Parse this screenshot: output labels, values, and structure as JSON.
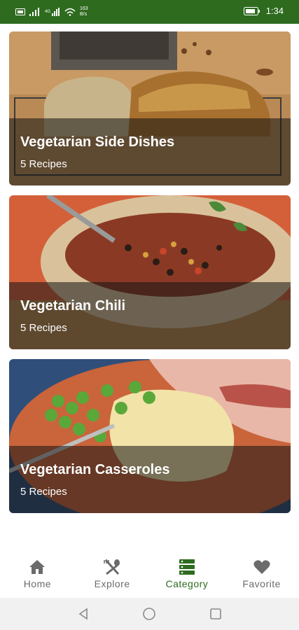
{
  "status_bar": {
    "speed_value": "163",
    "speed_unit": "B/s",
    "time": "1:34",
    "color": "#2e6b1f"
  },
  "categories": [
    {
      "title": "Vegetarian Side Dishes",
      "count": "5 Recipes"
    },
    {
      "title": "Vegetarian Chili",
      "count": "5 Recipes"
    },
    {
      "title": "Vegetarian Casseroles",
      "count": "5 Recipes"
    }
  ],
  "bottom_nav": {
    "items": [
      {
        "label": "Home",
        "icon": "home-icon"
      },
      {
        "label": "Explore",
        "icon": "fork-spoon-icon"
      },
      {
        "label": "Category",
        "icon": "category-icon",
        "active": true
      },
      {
        "label": "Favorite",
        "icon": "heart-icon"
      }
    ],
    "active_color": "#2e6b1f",
    "inactive_color": "#6b6b6b"
  },
  "system_nav": {
    "buttons": [
      "back-icon",
      "home-circle-icon",
      "recents-icon"
    ]
  }
}
